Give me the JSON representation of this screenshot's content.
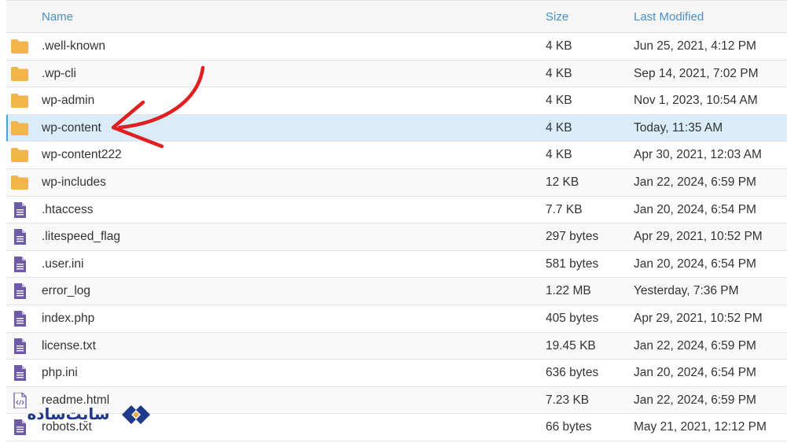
{
  "header": {
    "name": "Name",
    "size": "Size",
    "modified": "Last Modified"
  },
  "colors": {
    "folder": "#f3b54a",
    "file": "#6f5aa6",
    "header_text": "#4a90c8",
    "selected_row": "#d9ecf8",
    "arrow": "#e02020"
  },
  "files": [
    {
      "name": ".well-known",
      "size": "4 KB",
      "modified": "Jun 25, 2021, 4:12 PM",
      "icon": "folder-icon"
    },
    {
      "name": ".wp-cli",
      "size": "4 KB",
      "modified": "Sep 14, 2021, 7:02 PM",
      "icon": "folder-icon"
    },
    {
      "name": "wp-admin",
      "size": "4 KB",
      "modified": "Nov 1, 2023, 10:54 AM",
      "icon": "folder-icon"
    },
    {
      "name": "wp-content",
      "size": "4 KB",
      "modified": "Today, 11:35 AM",
      "icon": "folder-icon",
      "selected": true
    },
    {
      "name": "wp-content222",
      "size": "4 KB",
      "modified": "Apr 30, 2021, 12:03 AM",
      "icon": "folder-icon"
    },
    {
      "name": "wp-includes",
      "size": "12 KB",
      "modified": "Jan 22, 2024, 6:59 PM",
      "icon": "folder-icon"
    },
    {
      "name": ".htaccess",
      "size": "7.7 KB",
      "modified": "Jan 20, 2024, 6:54 PM",
      "icon": "file-icon"
    },
    {
      "name": ".litespeed_flag",
      "size": "297 bytes",
      "modified": "Apr 29, 2021, 10:52 PM",
      "icon": "file-icon"
    },
    {
      "name": ".user.ini",
      "size": "581 bytes",
      "modified": "Jan 20, 2024, 6:54 PM",
      "icon": "file-icon"
    },
    {
      "name": "error_log",
      "size": "1.22 MB",
      "modified": "Yesterday, 7:36 PM",
      "icon": "file-icon"
    },
    {
      "name": "index.php",
      "size": "405 bytes",
      "modified": "Apr 29, 2021, 10:52 PM",
      "icon": "file-icon"
    },
    {
      "name": "license.txt",
      "size": "19.45 KB",
      "modified": "Jan 22, 2024, 6:59 PM",
      "icon": "file-icon"
    },
    {
      "name": "php.ini",
      "size": "636 bytes",
      "modified": "Jan 20, 2024, 6:54 PM",
      "icon": "file-icon"
    },
    {
      "name": "readme.html",
      "size": "7.23 KB",
      "modified": "Jan 22, 2024, 6:59 PM",
      "icon": "code-file-icon"
    },
    {
      "name": "robots.txt",
      "size": "66 bytes",
      "modified": "May 21, 2021, 12:12 PM",
      "icon": "file-icon"
    }
  ],
  "watermark": {
    "text": "سایت‌ساده"
  }
}
